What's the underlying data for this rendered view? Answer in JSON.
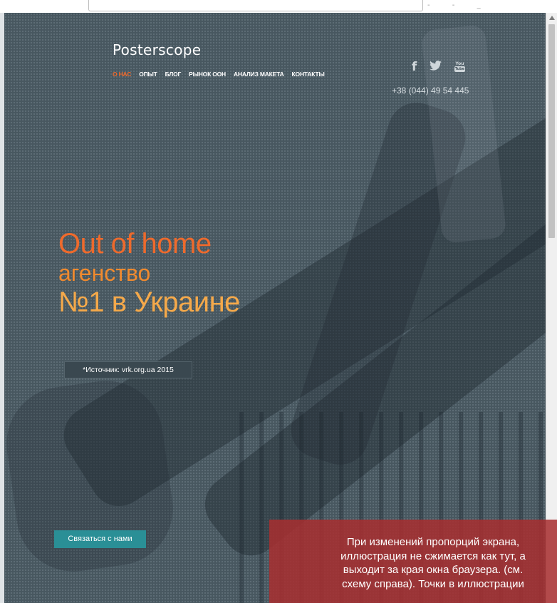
{
  "site": {
    "logo": "Posterscope",
    "nav": [
      {
        "label": "О НАС",
        "active": true
      },
      {
        "label": "ОПЫТ",
        "active": false
      },
      {
        "label": "БЛОГ",
        "active": false
      },
      {
        "label": "РЫНОК ООН",
        "active": false
      },
      {
        "label": "АНАЛИЗ МАКЕТА",
        "active": false
      },
      {
        "label": "КОНТАКТЫ",
        "active": false
      }
    ],
    "social": {
      "facebook": "f",
      "twitter": "🐦",
      "youtube_top": "You",
      "youtube_bottom": "Tube"
    },
    "social_icons": [
      "facebook-icon",
      "twitter-icon",
      "youtube-icon"
    ],
    "phone": "+38 (044) 49 54 445"
  },
  "hero": {
    "line1": "Out of home",
    "line2": "агенство",
    "line3": "№1 в Украине",
    "source": "*Источник: vrk.org.ua 2015",
    "cta": "Связаться с нами"
  },
  "note": {
    "text": "При изменений пропорций экрана,\nиллюстрация не сжимается как тут, а\nвыходит за  края окна браузера. (см.\nсхему справа). Точки в иллюстрации"
  },
  "colors": {
    "background": "#485760",
    "accent_orange": "#ee6a2c",
    "accent_amber": "#f5a94a",
    "button_teal": "#2a8f96",
    "note_red": "#a82e30"
  }
}
